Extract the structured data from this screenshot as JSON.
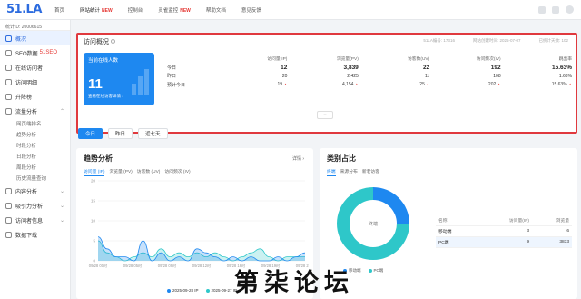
{
  "topbar": {
    "logo": "51.LA",
    "logo_sub": "网站统计",
    "nav": [
      {
        "label": "首页",
        "badge": ""
      },
      {
        "label": "网站统计",
        "badge": "NEW"
      },
      {
        "label": "控制台",
        "badge": ""
      },
      {
        "label": "灵雀监控",
        "badge": "NEW"
      },
      {
        "label": "帮助文档",
        "badge": ""
      },
      {
        "label": "意见反馈",
        "badge": ""
      }
    ]
  },
  "sidebar": {
    "site_id": "统计ID: 20006615",
    "items": [
      {
        "label": "概况",
        "active": true
      },
      {
        "label": "SEO数据",
        "badge": "51SEO"
      },
      {
        "label": "在线访问者"
      },
      {
        "label": "访问明细"
      },
      {
        "label": "升降榜"
      },
      {
        "label": "流量分析",
        "expand": "⌃"
      }
    ],
    "subitems": [
      "网页端排名",
      "趋势分析",
      "时段分析",
      "日段分析",
      "周段分析",
      "历史流量查询"
    ],
    "bottom": [
      {
        "label": "内容分析",
        "expand": "⌄"
      },
      {
        "label": "吸引力分析",
        "expand": "⌄"
      },
      {
        "label": "访问者信息",
        "expand": "⌄"
      },
      {
        "label": "数据下载"
      }
    ]
  },
  "overview": {
    "title": "访问概况",
    "meta": [
      "51LA编号: 17316",
      "网站创建时间: 2025-07-07",
      "已统计天数: 102"
    ],
    "card": {
      "label": "当前在线人数",
      "value": "11",
      "link": "查看在线访客详情 ›"
    },
    "headers": [
      "访问量(IP)",
      "浏览量(PV)",
      "访客数(UV)",
      "访问频次(IV)",
      "跳出率"
    ],
    "rows": [
      {
        "label": "今日",
        "cells": [
          "12",
          "3,839",
          "22",
          "192",
          "15.63%"
        ]
      },
      {
        "label": "昨日",
        "cells": [
          "20",
          "2,425",
          "11",
          "108",
          "1.63%"
        ]
      },
      {
        "label": "预计今日",
        "cells": [
          "19",
          "4,154",
          "25",
          "202",
          "15.63%"
        ]
      }
    ],
    "scroll_glyph": "⌄"
  },
  "tabs": [
    "今日",
    "昨日",
    "近七天"
  ],
  "trend": {
    "title": "趋势分析",
    "detail": "详情 ›",
    "subtabs": [
      "访问量 (IP)",
      "浏览量 (PV)",
      "访客数 (UV)",
      "访问频次 (IV)"
    ]
  },
  "chart_data": {
    "type": "area",
    "yticks": [
      "20",
      "15",
      "10",
      "5",
      "0"
    ],
    "ylim": [
      0,
      20
    ],
    "categories": [
      "09/28 00时",
      "09/28 05时",
      "09/28 09时",
      "09/28 12时",
      "09/28 16时",
      "09/28 19时",
      "09/28 23时"
    ],
    "series": [
      {
        "name": "2025-09-28 IP",
        "color": "#1e88f0",
        "values": [
          6,
          3,
          1,
          1,
          0,
          5,
          0,
          2,
          0,
          1,
          0,
          3,
          2,
          1,
          0,
          1,
          0,
          1,
          0,
          0,
          1,
          0,
          1,
          2
        ]
      },
      {
        "name": "2025-09-27 IP",
        "color": "#2ec7c9",
        "values": [
          5,
          2,
          1,
          0,
          1,
          2,
          1,
          3,
          1,
          2,
          1,
          2,
          1,
          2,
          1,
          0,
          1,
          2,
          3,
          1,
          0,
          1,
          1,
          1
        ]
      }
    ]
  },
  "category": {
    "title": "类别占比",
    "subtabs": [
      "终端",
      "来源分布",
      "新老访客"
    ],
    "donut_center": "终端",
    "donut": [
      {
        "name": "移动端",
        "value": 3,
        "color": "#1e88f0"
      },
      {
        "name": "PC端",
        "value": 9,
        "color": "#2ec7c9"
      }
    ],
    "headers": [
      "名称",
      "访问量(IP)",
      "浏览量"
    ],
    "rows": [
      {
        "name": "移动端",
        "ip": "3",
        "pv": "6"
      },
      {
        "name": "PC端",
        "ip": "9",
        "pv": "3833"
      }
    ]
  },
  "watermark": "第柒论坛"
}
